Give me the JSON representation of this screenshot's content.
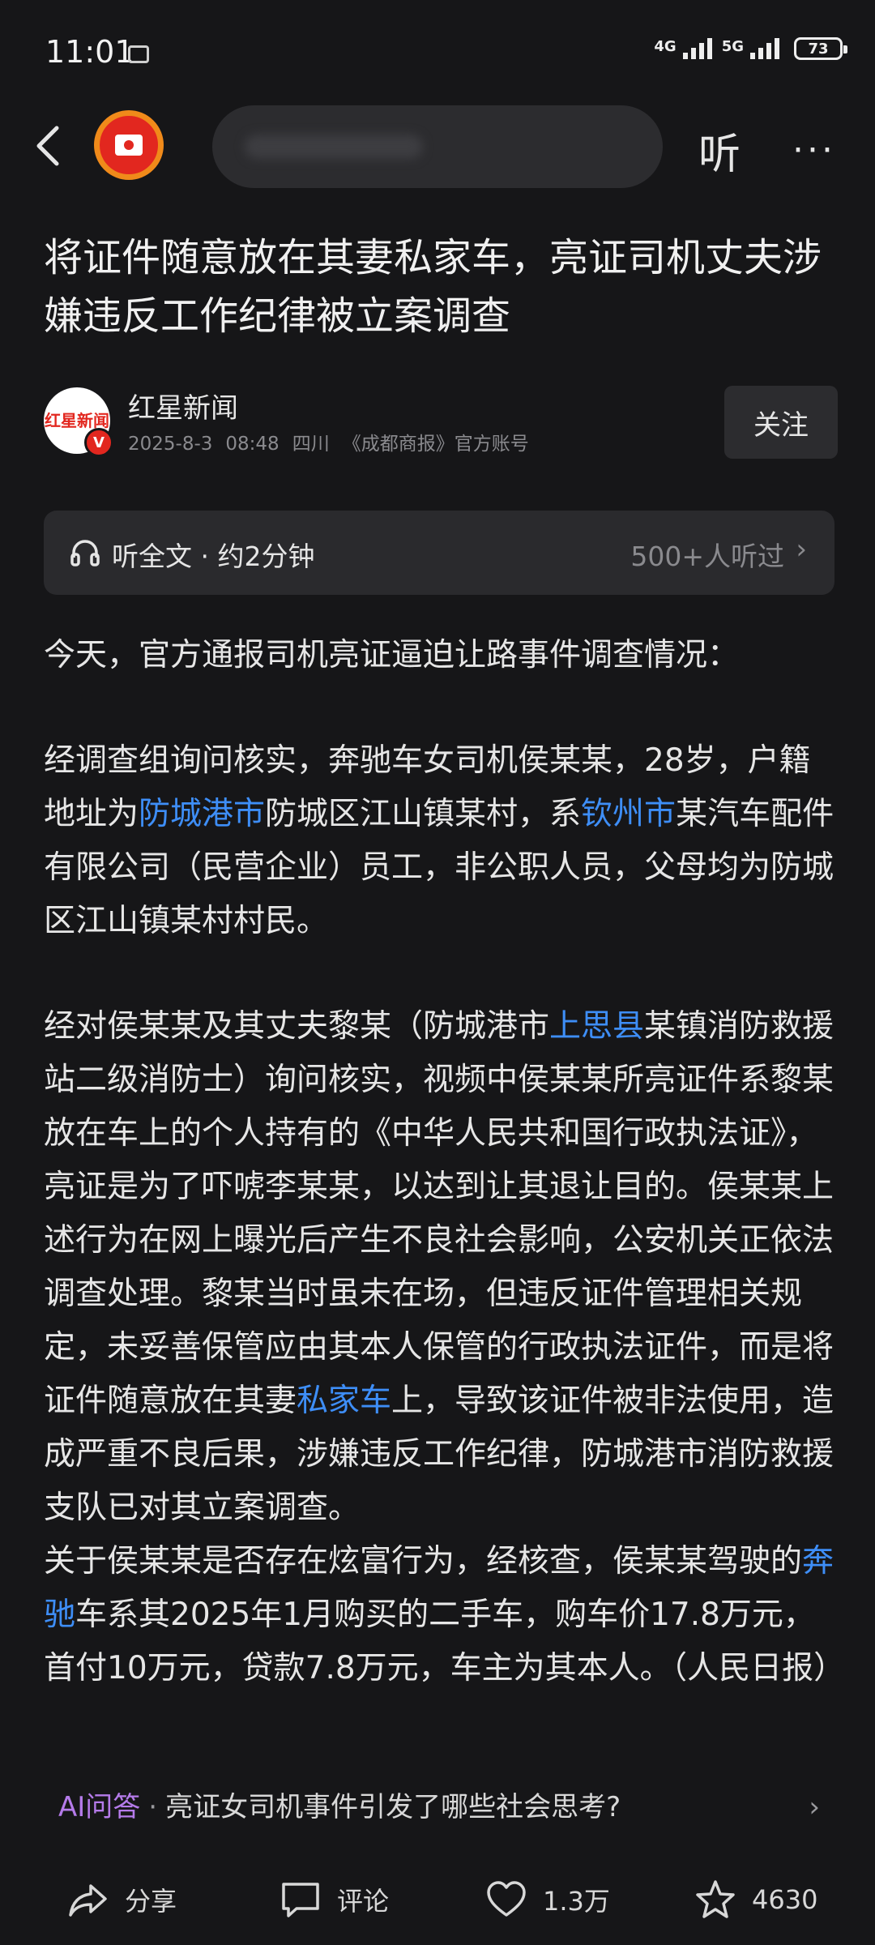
{
  "status_bar": {
    "time": "11:01",
    "network_1": "4G",
    "network_2": "5G",
    "battery": "73"
  },
  "top_bar": {
    "listen_label": "听",
    "more_label": "···"
  },
  "article": {
    "title": "将证件随意放在其妻私家车，亮证司机丈夫涉嫌违反工作纪律被立案调查",
    "author": {
      "name": "红星新闻",
      "avatar_text": "红星新闻",
      "badge": "V",
      "date": "2025-8-3",
      "time": "08:48",
      "location": "四川",
      "source": "《成都商报》官方账号"
    },
    "follow_label": "关注",
    "listen_bar": {
      "label": "听全文 · 约2分钟",
      "count": "500+人听过"
    },
    "para1": "今天，官方通报司机亮证逼迫让路事件调查情况：",
    "para2": {
      "t1": "经调查组询问核实，奔驰车女司机侯某某，28岁，户籍地址为",
      "link1": "防城港市",
      "t2": "防城区江山镇某村，系",
      "link2": "钦州市",
      "t3": "某汽车配件有限公司（民营企业）员工，非公职人员，父母均为防城区江山镇某村村民。"
    },
    "para3": {
      "t1": "经对侯某某及其丈夫黎某（防城港市",
      "link1": "上思县",
      "t2": "某镇消防救援站二级消防士）询问核实，视频中侯某某所亮证件系黎某放在车上的个人持有的《中华人民共和国行政执法证》，亮证是为了吓唬李某某，以达到让其退让目的。侯某某上述行为在网上曝光后产生不良社会影响，公安机关正依法调查处理。黎某当时虽未在场，但违反证件管理相关规定，未妥善保管应由其本人保管的行政执法证件，而是将证件随意放在其妻",
      "link2": "私家车",
      "t3": "上，导致该证件被非法使用，造成严重不良后果，涉嫌违反工作纪律，防城港市消防救援支队已对其立案调查。"
    },
    "para4": {
      "t1": "关于侯某某是否存在炫富行为，经核查，侯某某驾驶的",
      "link1": "奔驰",
      "t2": "车系其2025年1月购买的二手车，购车价17.8万元，首付10万元，贷款7.8万元，车主为其本人。（人民日报）"
    }
  },
  "ai_question": {
    "label": "AI问答",
    "separator": "·",
    "question": "亮证女司机事件引发了哪些社会思考?",
    "chevron": "›"
  },
  "bottom_bar": {
    "share_label": "分享",
    "comment_label": "评论",
    "like_count": "1.3万",
    "favorite_count": "4630"
  },
  "colors": {
    "background": "#161618",
    "link": "#3e8ef7",
    "ai_accent": "#b57bea",
    "brand_red": "#e2271f",
    "avatar_ring": "#f08a1a"
  },
  "icons": [
    "back-icon",
    "account-avatar",
    "headphone-icon",
    "share-icon",
    "comment-icon",
    "like-icon",
    "favorite-icon"
  ]
}
